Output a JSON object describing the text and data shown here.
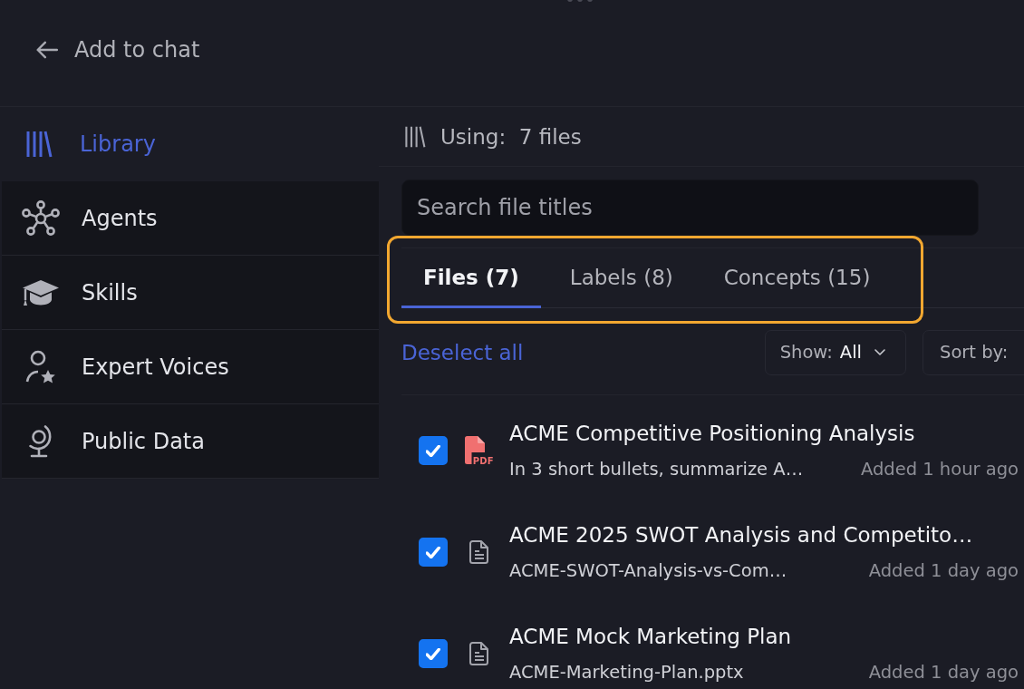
{
  "header": {
    "back_label": "Add to chat"
  },
  "sidebar": {
    "items": [
      {
        "kind": "library",
        "label": "Library",
        "selected": true
      },
      {
        "kind": "agents",
        "label": "Agents",
        "selected": false
      },
      {
        "kind": "skills",
        "label": "Skills",
        "selected": false
      },
      {
        "kind": "experts",
        "label": "Expert Voices",
        "selected": false
      },
      {
        "kind": "public_data",
        "label": "Public Data",
        "selected": false
      }
    ]
  },
  "usage": {
    "label": "Using:  7 files"
  },
  "search": {
    "placeholder": "Search file titles"
  },
  "tab_bar": {
    "highlighted": true,
    "tabs": [
      {
        "label": "Files (7)",
        "selected": true
      },
      {
        "label": "Labels (8)",
        "selected": false
      },
      {
        "label": "Concepts (15)",
        "selected": false
      }
    ]
  },
  "toolbar": {
    "deselect_label": "Deselect all",
    "filters": [
      {
        "label": "Show:",
        "value": "All"
      },
      {
        "label": "Sort by:"
      }
    ]
  },
  "files": [
    {
      "kind": "pdf",
      "type_label": "PDF",
      "title": "ACME Competitive Positioning Analysis",
      "subtitle": "In 3 short bullets, summarize A…",
      "added": "Added 1 hour ago",
      "checked": true
    },
    {
      "kind": "doc",
      "title": "ACME 2025 SWOT Analysis and Competito…",
      "subtitle": "ACME-SWOT-Analysis-vs-Com…",
      "added": "Added 1 day ago",
      "checked": true
    },
    {
      "kind": "doc",
      "title": "ACME Mock Marketing Plan",
      "subtitle": "ACME-Marketing-Plan.pptx",
      "added": "Added 1 day ago",
      "checked": true
    }
  ]
}
